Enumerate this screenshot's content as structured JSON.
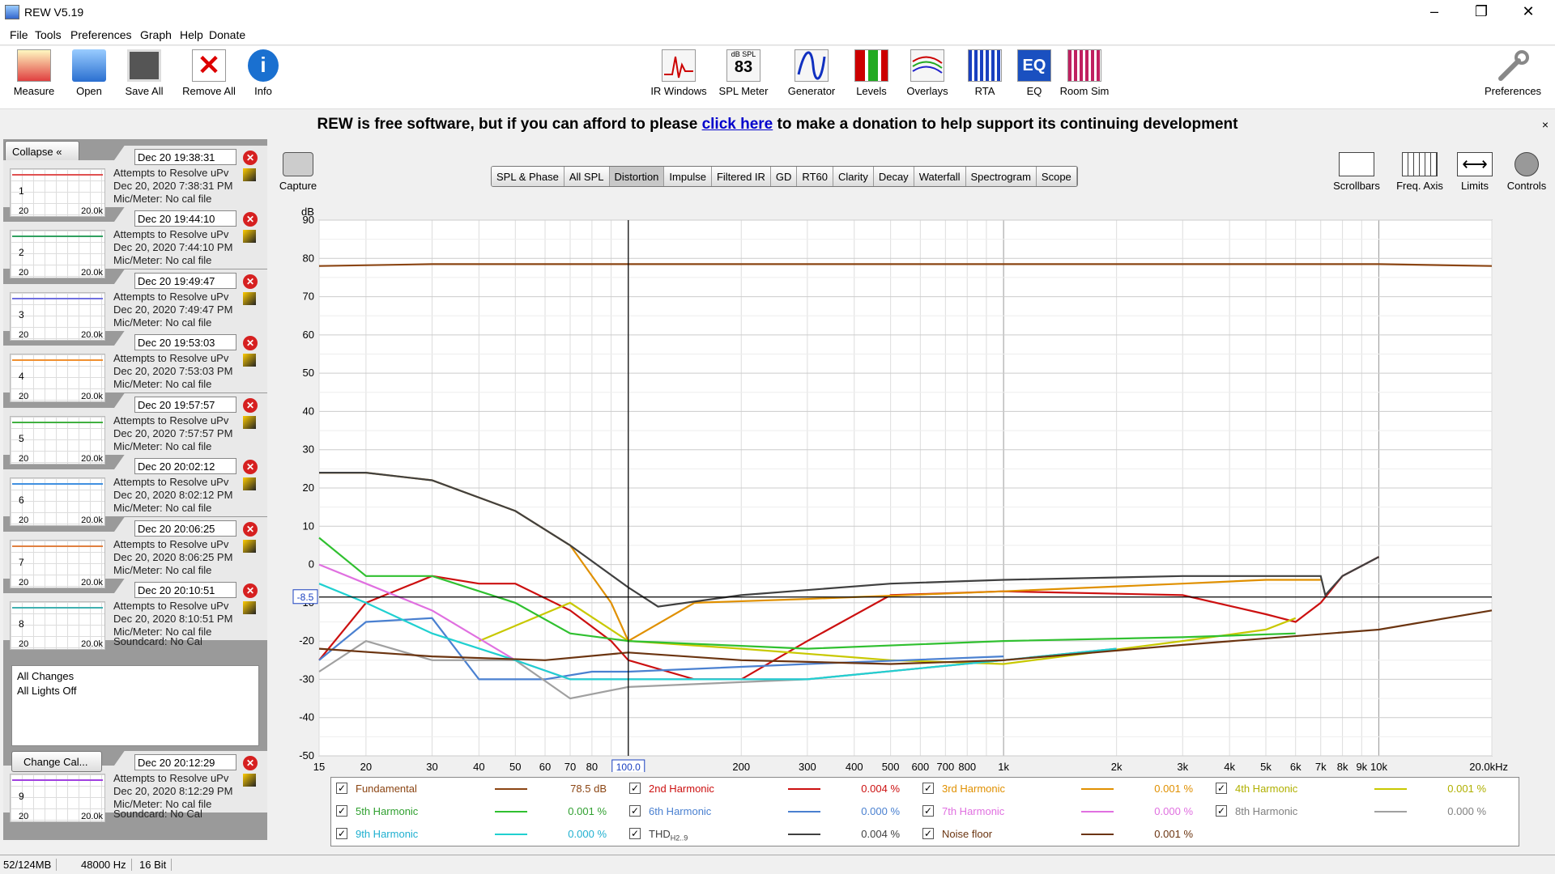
{
  "window": {
    "title": "REW V5.19"
  },
  "menu": [
    "File",
    "Tools",
    "Preferences",
    "Graph",
    "Help",
    "Donate"
  ],
  "toolbar_left": [
    {
      "label": "Measure",
      "icon": "measure-icon"
    },
    {
      "label": "Open",
      "icon": "folder-icon"
    },
    {
      "label": "Save All",
      "icon": "save-icon"
    },
    {
      "label": "Remove All",
      "icon": "remove-all-icon"
    },
    {
      "label": "Info",
      "icon": "info-icon"
    }
  ],
  "toolbar_center": [
    {
      "label": "IR Windows",
      "icon": "ir-windows-icon"
    },
    {
      "label": "SPL Meter",
      "icon": "spl-meter-icon",
      "reading": "83",
      "unit": "dB SPL"
    },
    {
      "label": "Generator",
      "icon": "generator-icon"
    },
    {
      "label": "Levels",
      "icon": "levels-icon"
    },
    {
      "label": "Overlays",
      "icon": "overlays-icon"
    },
    {
      "label": "RTA",
      "icon": "rta-icon"
    },
    {
      "label": "EQ",
      "icon": "eq-icon"
    },
    {
      "label": "Room Sim",
      "icon": "room-sim-icon"
    }
  ],
  "toolbar_right": {
    "label": "Preferences",
    "icon": "wrench-icon"
  },
  "donate": {
    "before": "REW is free software, but if you can afford to please",
    "link": "click here",
    "after": "to make a donation to help support its continuing development",
    "close": "×"
  },
  "sidepanel": {
    "collapse_label": "Collapse",
    "measurements": [
      {
        "num": "1",
        "date": "Dec 20 19:38:31",
        "name": "Attempts to Resolve uPv",
        "full_date": "Dec 20, 2020 7:38:31 PM",
        "mic": "Mic/Meter: No cal file",
        "color": "#e05050",
        "lo": "20",
        "hi": "20.0k"
      },
      {
        "num": "2",
        "date": "Dec 20 19:44:10",
        "name": "Attempts to Resolve uPv",
        "full_date": "Dec 20, 2020 7:44:10 PM",
        "mic": "Mic/Meter: No cal file",
        "color": "#30a060",
        "lo": "20",
        "hi": "20.0k"
      },
      {
        "num": "3",
        "date": "Dec 20 19:49:47",
        "name": "Attempts to Resolve uPv",
        "full_date": "Dec 20, 2020 7:49:47 PM",
        "mic": "Mic/Meter: No cal file",
        "color": "#7070e0",
        "lo": "20",
        "hi": "20.0k"
      },
      {
        "num": "4",
        "date": "Dec 20 19:53:03",
        "name": "Attempts to Resolve uPv",
        "full_date": "Dec 20, 2020 7:53:03 PM",
        "mic": "Mic/Meter: No cal file",
        "color": "#f09030",
        "lo": "20",
        "hi": "20.0k"
      },
      {
        "num": "5",
        "date": "Dec 20 19:57:57",
        "name": "Attempts to Resolve uPv",
        "full_date": "Dec 20, 2020 7:57:57 PM",
        "mic": "Mic/Meter: No cal file",
        "color": "#40b040",
        "lo": "20",
        "hi": "20.0k"
      },
      {
        "num": "6",
        "date": "Dec 20 20:02:12",
        "name": "Attempts to Resolve uPv",
        "full_date": "Dec 20, 2020 8:02:12 PM",
        "mic": "Mic/Meter: No cal file",
        "color": "#4090e0",
        "lo": "20",
        "hi": "20.0k"
      },
      {
        "num": "7",
        "date": "Dec 20 20:06:25",
        "name": "Attempts to Resolve uPv",
        "full_date": "Dec 20, 2020 8:06:25 PM",
        "mic": "Mic/Meter: No cal file",
        "color": "#e08040",
        "lo": "20",
        "hi": "20.0k"
      },
      {
        "num": "8",
        "date": "Dec 20 20:10:51",
        "name": "Attempts to Resolve uPv",
        "full_date": "Dec 20, 2020 8:10:51 PM",
        "mic": "Mic/Meter: No cal file",
        "soundcard": "Soundcard: No Cal",
        "color": "#40b0b0",
        "lo": "20",
        "hi": "20.0k"
      },
      {
        "num": "9",
        "date": "Dec 20 20:12:29",
        "name": "Attempts to Resolve uPv",
        "full_date": "Dec 20, 2020 8:12:29 PM",
        "mic": "Mic/Meter: No cal file",
        "soundcard": "Soundcard: No Cal",
        "color": "#a040e0",
        "lo": "20",
        "hi": "20.0k"
      }
    ],
    "changes": [
      "All Changes",
      "All Lights Off"
    ],
    "change_cal_label": "Change Cal..."
  },
  "capture_label": "Capture",
  "graph_tabs": [
    "SPL & Phase",
    "All SPL",
    "Distortion",
    "Impulse",
    "Filtered IR",
    "GD",
    "RT60",
    "Clarity",
    "Decay",
    "Waterfall",
    "Spectrogram",
    "Scope"
  ],
  "selected_tab": "Distortion",
  "right_controls": [
    {
      "label": "Scrollbars",
      "icon": "scrollbars-icon"
    },
    {
      "label": "Freq. Axis",
      "icon": "freq-axis-icon"
    },
    {
      "label": "Limits",
      "icon": "limits-icon"
    },
    {
      "label": "Controls",
      "icon": "gear-icon"
    }
  ],
  "chart_data": {
    "type": "line",
    "ylabel": "dB",
    "ylim": [
      -50,
      90
    ],
    "xlim": [
      15,
      20000
    ],
    "xscale": "log",
    "y_ticks": [
      "90",
      "80",
      "70",
      "60",
      "50",
      "40",
      "30",
      "20",
      "10",
      "0",
      "-10",
      "-20",
      "-30",
      "-40",
      "-50"
    ],
    "x_ticks": [
      {
        "f": 15,
        "label": "15"
      },
      {
        "f": 20,
        "label": "20"
      },
      {
        "f": 30,
        "label": "30"
      },
      {
        "f": 40,
        "label": "40"
      },
      {
        "f": 50,
        "label": "50"
      },
      {
        "f": 60,
        "label": "60"
      },
      {
        "f": 70,
        "label": "70"
      },
      {
        "f": 80,
        "label": "80"
      },
      {
        "f": 100,
        "label": "100.0"
      },
      {
        "f": 200,
        "label": "200"
      },
      {
        "f": 300,
        "label": "300"
      },
      {
        "f": 400,
        "label": "400"
      },
      {
        "f": 500,
        "label": "500"
      },
      {
        "f": 600,
        "label": "600"
      },
      {
        "f": 700,
        "label": "700"
      },
      {
        "f": 800,
        "label": "800"
      },
      {
        "f": 1000,
        "label": "1k"
      },
      {
        "f": 2000,
        "label": "2k"
      },
      {
        "f": 3000,
        "label": "3k"
      },
      {
        "f": 4000,
        "label": "4k"
      },
      {
        "f": 5000,
        "label": "5k"
      },
      {
        "f": 6000,
        "label": "6k"
      },
      {
        "f": 7000,
        "label": "7k"
      },
      {
        "f": 8000,
        "label": "8k"
      },
      {
        "f": 9000,
        "label": "9k"
      },
      {
        "f": 10000,
        "label": "10k"
      },
      {
        "f": 20000,
        "label": "20.0kHz"
      }
    ],
    "cursor": {
      "f": 100,
      "db": -8.5,
      "f_label": "100.0",
      "db_label": "-8.5"
    },
    "series": [
      {
        "name": "Fundamental",
        "color": "#8b4513",
        "x": [
          15,
          30,
          100,
          1000,
          5000,
          10000,
          20000
        ],
        "y": [
          78,
          78.5,
          78.5,
          78.5,
          78.5,
          78.5,
          78
        ]
      },
      {
        "name": "2nd Harmonic",
        "color": "#cc1010",
        "x": [
          15,
          20,
          30,
          40,
          50,
          70,
          90,
          100,
          150,
          200,
          300,
          500,
          1000,
          3000,
          5000,
          6000,
          7000,
          8000,
          10000
        ],
        "y": [
          -25,
          -10,
          -3,
          -5,
          -5,
          -12,
          -20,
          -25,
          -30,
          -30,
          -20,
          -8,
          -7,
          -8,
          -13,
          -15,
          -10,
          -3,
          2
        ]
      },
      {
        "name": "3rd Harmonic",
        "color": "#e09000",
        "x": [
          15,
          20,
          30,
          50,
          70,
          90,
          100,
          150,
          300,
          1000,
          3000,
          5000,
          7000
        ],
        "y": [
          24,
          24,
          22,
          14,
          5,
          -10,
          -20,
          -10,
          -9,
          -7,
          -5,
          -4,
          -4
        ]
      },
      {
        "name": "4th Harmonic",
        "color": "#c8c800",
        "x": [
          40,
          70,
          100,
          200,
          500,
          1000,
          3000,
          5000,
          6000
        ],
        "y": [
          -20,
          -10,
          -20,
          -22,
          -25,
          -26,
          -20,
          -17,
          -14
        ]
      },
      {
        "name": "5th Harmonic",
        "color": "#30c030",
        "x": [
          15,
          20,
          30,
          50,
          70,
          100,
          300,
          1000,
          3000,
          6000
        ],
        "y": [
          7,
          -3,
          -3,
          -10,
          -18,
          -20,
          -22,
          -20,
          -19,
          -18
        ]
      },
      {
        "name": "6th Harmonic",
        "color": "#4a80d0",
        "x": [
          15,
          20,
          30,
          40,
          60,
          80,
          100,
          300,
          1000
        ],
        "y": [
          -25,
          -15,
          -14,
          -30,
          -30,
          -28,
          -28,
          -26,
          -24
        ]
      },
      {
        "name": "7th Harmonic",
        "color": "#e070e0",
        "x": [
          15,
          20,
          30,
          50,
          70,
          100,
          300,
          1000,
          2000
        ],
        "y": [
          0,
          -5,
          -12,
          -25,
          -30,
          -30,
          -30,
          -25,
          -22
        ]
      },
      {
        "name": "8th Harmonic",
        "color": "#a0a0a0",
        "x": [
          15,
          20,
          30,
          50,
          70,
          100,
          300,
          1000,
          2000
        ],
        "y": [
          -28,
          -20,
          -25,
          -25,
          -35,
          -32,
          -30,
          -25,
          -22
        ]
      },
      {
        "name": "9th Harmonic",
        "color": "#20d0d0",
        "x": [
          15,
          20,
          30,
          50,
          70,
          100,
          300,
          1000,
          2000
        ],
        "y": [
          -5,
          -10,
          -18,
          -25,
          -30,
          -30,
          -30,
          -25,
          -22
        ]
      },
      {
        "name": "THD H2..9",
        "color": "#404040",
        "x": [
          15,
          20,
          30,
          50,
          70,
          100,
          120,
          200,
          500,
          1000,
          3000,
          3700,
          3800,
          3900,
          5000,
          7000,
          7200,
          8000,
          10000
        ],
        "y": [
          24,
          24,
          22,
          14,
          5,
          -6,
          -11,
          -8,
          -5,
          -4,
          -3,
          -3,
          -3,
          -3,
          -3,
          -3,
          -8,
          -3,
          2
        ]
      },
      {
        "name": "Noise floor",
        "color": "#6b3410",
        "x": [
          15,
          30,
          60,
          100,
          200,
          500,
          1000,
          3000,
          10000,
          20000
        ],
        "y": [
          -22,
          -24,
          -25,
          -23,
          -25,
          -26,
          -25,
          -21,
          -17,
          -12
        ]
      }
    ]
  },
  "legend": [
    {
      "name": "Fundamental",
      "value": "78.5 dB",
      "color": "#8b4513",
      "text_color": "#8b4513"
    },
    {
      "name": "2nd Harmonic",
      "value": "0.004 %",
      "color": "#cc1010",
      "text_color": "#cc1010"
    },
    {
      "name": "3rd Harmonic",
      "value": "0.001 %",
      "color": "#e09000",
      "text_color": "#e09000"
    },
    {
      "name": "4th Harmonic",
      "value": "0.001 %",
      "color": "#c8c800",
      "text_color": "#b0b000"
    },
    {
      "name": "5th Harmonic",
      "value": "0.001 %",
      "color": "#30c030",
      "text_color": "#30a030"
    },
    {
      "name": "6th Harmonic",
      "value": "0.000 %",
      "color": "#4a80d0",
      "text_color": "#4a80d0"
    },
    {
      "name": "7th Harmonic",
      "value": "0.000 %",
      "color": "#e070e0",
      "text_color": "#e070e0"
    },
    {
      "name": "8th Harmonic",
      "value": "0.000 %",
      "color": "#a0a0a0",
      "text_color": "#808080"
    },
    {
      "name": "9th Harmonic",
      "value": "0.000 %",
      "color": "#20d0d0",
      "text_color": "#20b0d0"
    },
    {
      "name": "THD",
      "sub": "H2..9",
      "value": "0.004 %",
      "color": "#404040",
      "text_color": "#404040"
    },
    {
      "name": "Noise floor",
      "value": "0.001 %",
      "color": "#6b3410",
      "text_color": "#6b3410"
    }
  ],
  "status": {
    "memory": "52/124MB",
    "rate": "48000 Hz",
    "bits": "16 Bit"
  }
}
